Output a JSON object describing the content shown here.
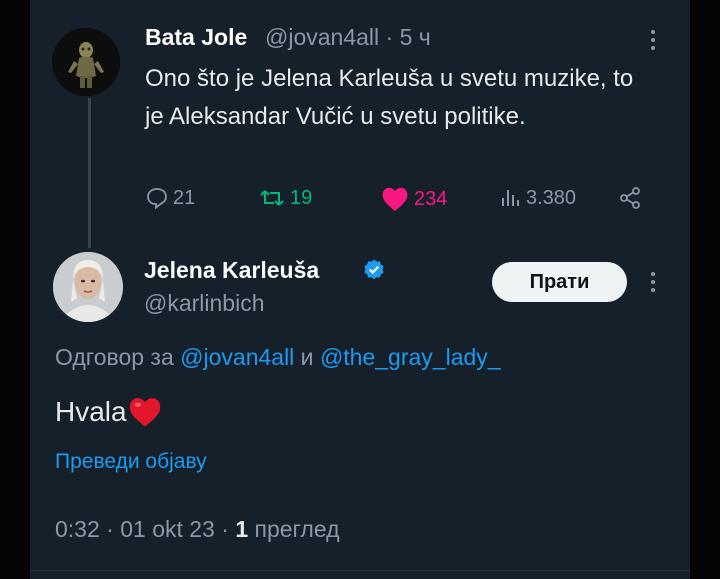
{
  "tweet1": {
    "name": "Bata Jole",
    "handle": "@jovan4all",
    "separator": " · ",
    "time": "5 ч",
    "text": "Ono što je Jelena Karleuša u svetu muzike, to je Aleksandar Vučić u svetu politike.",
    "actions": {
      "replies": "21",
      "retweets": "19",
      "likes": "234",
      "views": "3.380"
    }
  },
  "tweet2": {
    "name": "Jelena Karleuša",
    "handle": "@karlinbich",
    "follow_label": "Прати",
    "reply_prefix": "Одговор за ",
    "reply_user1": "@jovan4all",
    "reply_and": " и ",
    "reply_user2": "@the_gray_lady_",
    "text": "Hvala",
    "translate_label": "Преведи објаву",
    "time": "0:32",
    "date": "01 okt 23",
    "views_count": "1",
    "views_label": " преглед"
  },
  "colors": {
    "background": "#15202b",
    "accent": "#1d9bf0",
    "retweet": "#00ba7c",
    "like": "#f91880"
  },
  "icons": [
    "reply-icon",
    "retweet-icon",
    "like-icon",
    "views-icon",
    "share-icon",
    "more-icon",
    "verified-badge-icon",
    "heart-emoji"
  ]
}
